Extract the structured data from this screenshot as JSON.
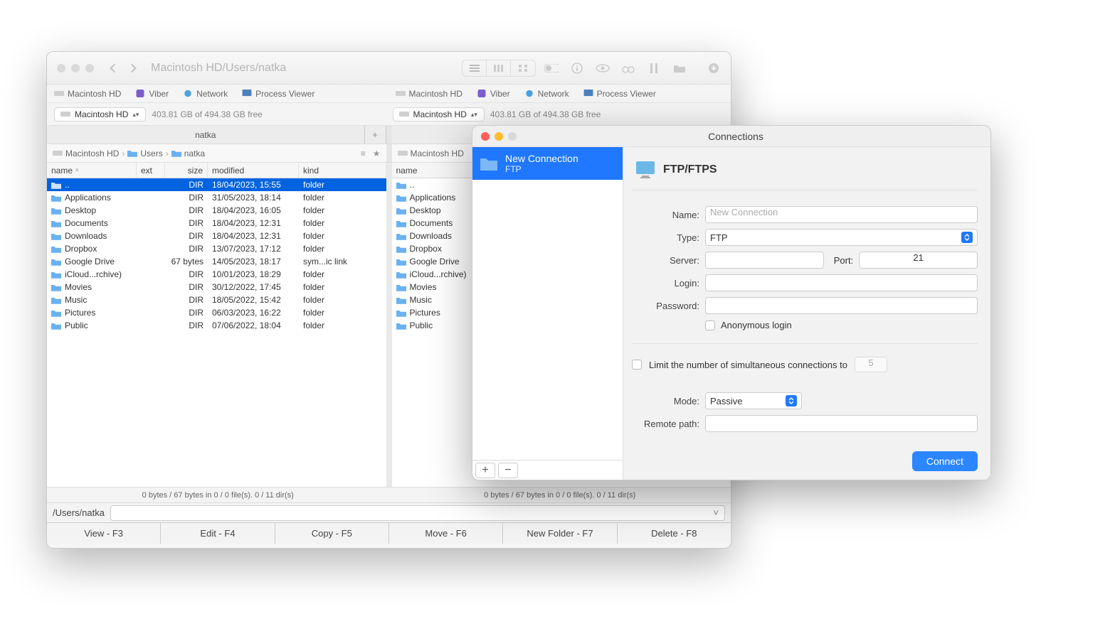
{
  "main": {
    "title": "Macintosh HD/Users/natka",
    "favorites": [
      "Macintosh HD",
      "Viber",
      "Network",
      "Process Viewer"
    ],
    "drive": {
      "name": "Macintosh HD",
      "free": "403.81 GB of 494.38 GB free"
    },
    "left": {
      "tab": "natka",
      "breadcrumb": [
        "Macintosh HD",
        "Users",
        "natka"
      ],
      "columns": {
        "name": "name",
        "ext": "ext",
        "size": "size",
        "modified": "modified",
        "kind": "kind"
      },
      "rows": [
        {
          "name": "..",
          "ext": "",
          "size": "DIR",
          "modified": "18/04/2023, 15:55",
          "kind": "folder",
          "selected": true
        },
        {
          "name": "Applications",
          "ext": "",
          "size": "DIR",
          "modified": "31/05/2023, 18:14",
          "kind": "folder"
        },
        {
          "name": "Desktop",
          "ext": "",
          "size": "DIR",
          "modified": "18/04/2023, 16:05",
          "kind": "folder"
        },
        {
          "name": "Documents",
          "ext": "",
          "size": "DIR",
          "modified": "18/04/2023, 12:31",
          "kind": "folder"
        },
        {
          "name": "Downloads",
          "ext": "",
          "size": "DIR",
          "modified": "18/04/2023, 12:31",
          "kind": "folder"
        },
        {
          "name": "Dropbox",
          "ext": "",
          "size": "DIR",
          "modified": "13/07/2023, 17:12",
          "kind": "folder"
        },
        {
          "name": "Google Drive",
          "ext": "",
          "size": "67 bytes",
          "modified": "14/05/2023, 18:17",
          "kind": "sym...ic link"
        },
        {
          "name": "iCloud...rchive)",
          "ext": "",
          "size": "DIR",
          "modified": "10/01/2023, 18:29",
          "kind": "folder"
        },
        {
          "name": "Movies",
          "ext": "",
          "size": "DIR",
          "modified": "30/12/2022, 17:45",
          "kind": "folder"
        },
        {
          "name": "Music",
          "ext": "",
          "size": "DIR",
          "modified": "18/05/2022, 15:42",
          "kind": "folder"
        },
        {
          "name": "Pictures",
          "ext": "",
          "size": "DIR",
          "modified": "06/03/2023, 16:22",
          "kind": "folder"
        },
        {
          "name": "Public",
          "ext": "",
          "size": "DIR",
          "modified": "07/06/2022, 18:04",
          "kind": "folder"
        }
      ],
      "status": "0 bytes / 67 bytes in 0 / 0 file(s). 0 / 11 dir(s)"
    },
    "right": {
      "tab": "",
      "breadcrumb": [
        "Macintosh HD"
      ],
      "columns": {
        "name": "name"
      },
      "rows": [
        {
          "name": ".."
        },
        {
          "name": "Applications"
        },
        {
          "name": "Desktop"
        },
        {
          "name": "Documents"
        },
        {
          "name": "Downloads"
        },
        {
          "name": "Dropbox"
        },
        {
          "name": "Google Drive"
        },
        {
          "name": "iCloud...rchive)"
        },
        {
          "name": "Movies"
        },
        {
          "name": "Music"
        },
        {
          "name": "Pictures"
        },
        {
          "name": "Public"
        }
      ],
      "status": "0 bytes / 67 bytes in 0 / 0 file(s). 0 / 11 dir(s)"
    },
    "path": "/Users/natka",
    "fn_buttons": [
      "View - F3",
      "Edit - F4",
      "Copy - F5",
      "Move - F6",
      "New Folder - F7",
      "Delete - F8"
    ]
  },
  "dialog": {
    "title": "Connections",
    "sidebar": {
      "item_title": "New Connection",
      "item_sub": "FTP"
    },
    "header_label": "FTP/FTPS",
    "labels": {
      "name": "Name:",
      "type": "Type:",
      "server": "Server:",
      "port": "Port:",
      "login": "Login:",
      "password": "Password:",
      "anon": "Anonymous login",
      "limit": "Limit the number of simultaneous connections to",
      "mode": "Mode:",
      "remote": "Remote path:",
      "connect": "Connect"
    },
    "values": {
      "name_placeholder": "New Connection",
      "type_value": "FTP",
      "port_value": "21",
      "limit_value": "5",
      "mode_value": "Passive"
    }
  }
}
